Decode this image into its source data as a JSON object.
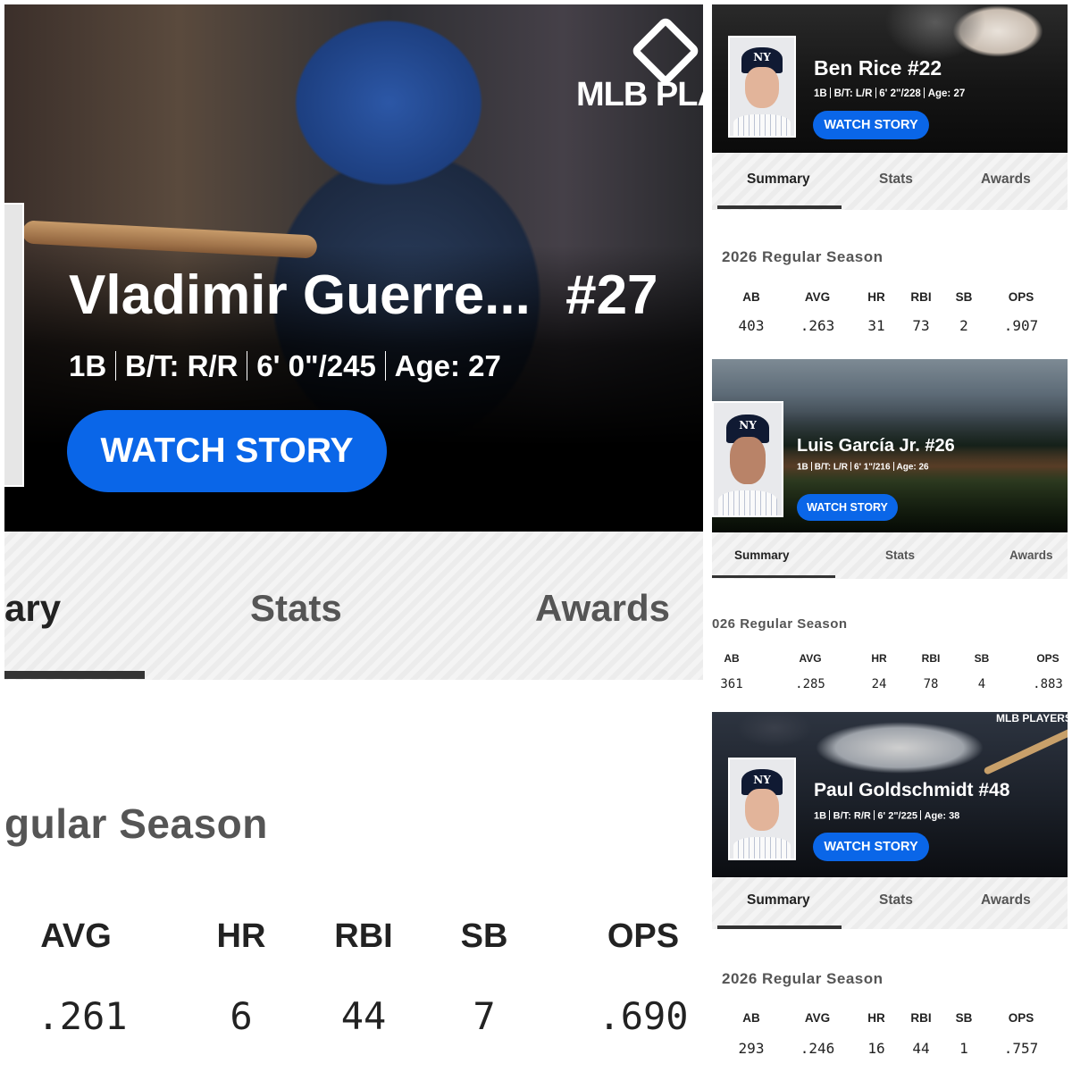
{
  "tabs": {
    "summary": "Summary",
    "stats": "Stats",
    "awards": "Awards"
  },
  "stat_headers": [
    "AB",
    "AVG",
    "HR",
    "RBI",
    "SB",
    "OPS"
  ],
  "colors": {
    "accent": "#0a66e8",
    "hero_bg": "#000000",
    "text": "#222222"
  },
  "panels": {
    "vlad": {
      "brand": "MLB PLAYE",
      "name": "Vladimir Guerre...",
      "number": "#27",
      "position": "1B",
      "bt": "B/T: R/R",
      "htwt": "6' 0\"/245",
      "age": "Age: 27",
      "watch": "WATCH STORY",
      "tab_summary": "ary",
      "season": "gular Season",
      "headers": [
        "AVG",
        "HR",
        "RBI",
        "SB",
        "OPS"
      ],
      "values": [
        ".261",
        "6",
        "44",
        "7",
        ".690"
      ]
    },
    "rice": {
      "name": "Ben Rice #22",
      "position": "1B",
      "bt": "B/T: L/R",
      "htwt": "6' 2\"/228",
      "age": "Age: 27",
      "watch": "WATCH STORY",
      "season": "2026 Regular Season",
      "values": [
        "403",
        ".263",
        "31",
        "73",
        "2",
        ".907"
      ]
    },
    "garcia": {
      "name": "Luis García Jr. #26",
      "position": "1B",
      "bt": "B/T: L/R",
      "htwt": "6' 1\"/216",
      "age": "Age: 26",
      "watch": "WATCH STORY",
      "season": "026 Regular Season",
      "values": [
        "361",
        ".285",
        "24",
        "78",
        "4",
        ".883"
      ]
    },
    "goldschmidt": {
      "brand": "MLB PLAYERS",
      "name": "Paul Goldschmidt #48",
      "position": "1B",
      "bt": "B/T: R/R",
      "htwt": "6' 2\"/225",
      "age": "Age: 38",
      "watch": "WATCH STORY",
      "season": "2026 Regular Season",
      "values": [
        "293",
        ".246",
        "16",
        "44",
        "1",
        ".757"
      ]
    }
  }
}
